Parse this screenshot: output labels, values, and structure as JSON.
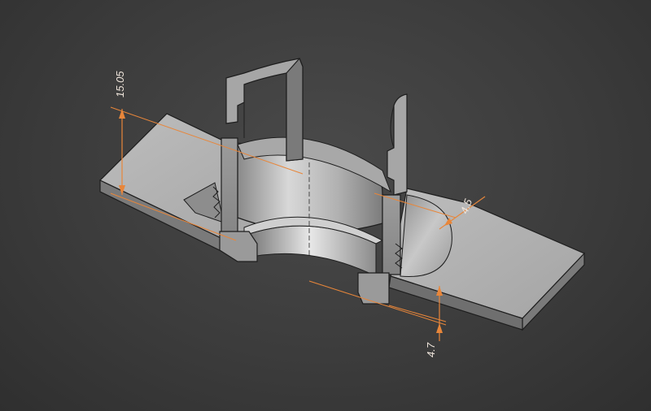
{
  "viewport": {
    "background": "#3c3c3c",
    "model": "section-view-of-cylindrical-fitting-with-flanges"
  },
  "colors": {
    "dimension": "#e8863a",
    "body_light": "#b4b4b4",
    "body_mid": "#9a9a9a",
    "body_dark": "#6e6e6e",
    "edge": "#1e1e1e"
  },
  "dimensions": [
    {
      "id": "height",
      "value": "15.05",
      "unit": "mm"
    },
    {
      "id": "wall",
      "value": "4.5",
      "unit": "mm"
    },
    {
      "id": "base",
      "value": "4.7",
      "unit": "mm"
    }
  ]
}
